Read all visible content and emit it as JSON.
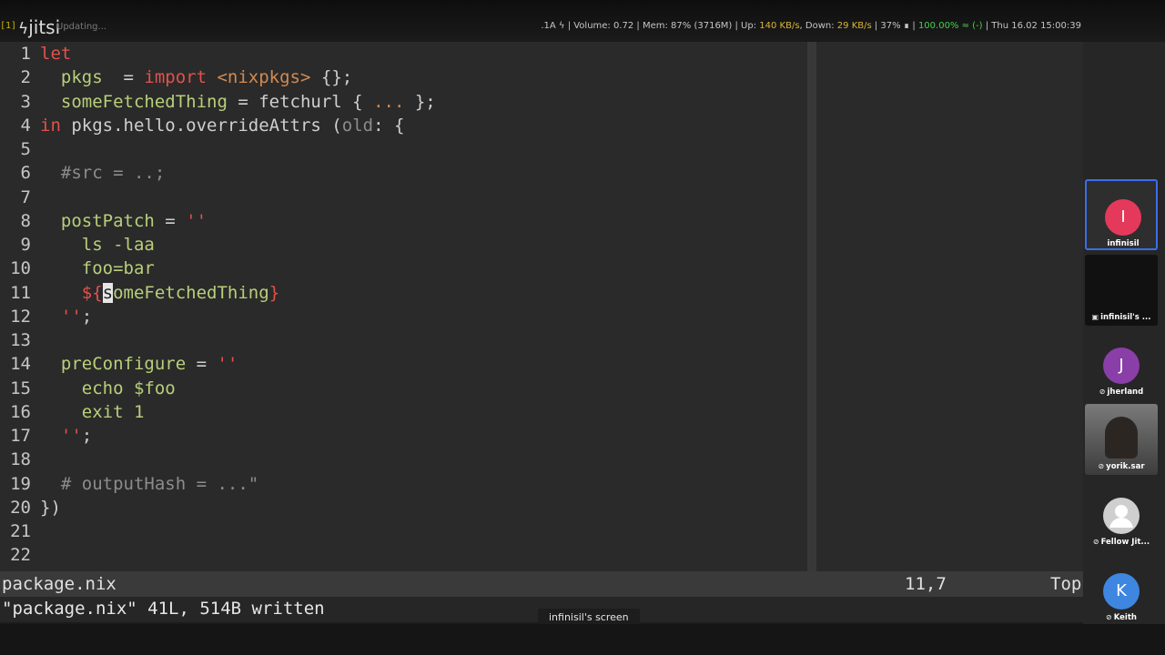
{
  "taskbar": {
    "workspace": "[1]",
    "app_name": "jitsi",
    "app_icon": "jitsi-bolt-icon",
    "updating_text": "Updating...",
    "status": {
      "prefix": ".1A ϟ | Volume: 0.72 | Mem: 87% (3716M) | Up: ",
      "up_speed": "140 KB/s",
      "down_label": ", Down: ",
      "down_speed": "29 KB/s",
      "battery": " | 37% ∎ | ",
      "charge": "100.00% ≈ (-)",
      "datetime": " | Thu 16.02 15:00:39"
    }
  },
  "editor": {
    "lines": [
      {
        "n": "1",
        "t": [
          [
            "kw",
            "let"
          ]
        ]
      },
      {
        "n": "2",
        "t": [
          [
            "id",
            "  pkgs"
          ],
          [
            "",
            "  = "
          ],
          [
            "kw",
            "import"
          ],
          [
            "",
            ""
          ],
          [
            "pth",
            " <nixpkgs>"
          ],
          [
            "",
            ""
          ],
          [
            "",
            " {};"
          ]
        ]
      },
      {
        "n": "3",
        "t": [
          [
            "id",
            "  someFetchedThing"
          ],
          [
            "",
            " = fetchurl { "
          ],
          [
            "nm",
            "..."
          ],
          [
            "",
            " };"
          ]
        ]
      },
      {
        "n": "4",
        "t": [
          [
            "kw",
            "in"
          ],
          [
            "",
            " pkgs.hello.overrideAttrs ("
          ],
          [
            "cm",
            "old"
          ],
          [
            "",
            ": {"
          ]
        ]
      },
      {
        "n": "5",
        "t": []
      },
      {
        "n": "6",
        "t": [
          [
            "cm",
            "  #src = ..;"
          ]
        ]
      },
      {
        "n": "7",
        "t": []
      },
      {
        "n": "8",
        "t": [
          [
            "id",
            "  postPatch"
          ],
          [
            "",
            " = "
          ],
          [
            "str",
            "''"
          ]
        ]
      },
      {
        "n": "9",
        "t": [
          [
            "id",
            "    ls -laa"
          ]
        ]
      },
      {
        "n": "10",
        "t": [
          [
            "id",
            "    foo=bar"
          ]
        ]
      },
      {
        "n": "11",
        "t": [
          [
            "str",
            "    ${"
          ],
          [
            "cur",
            "s"
          ],
          [
            "id",
            "omeFetchedThing"
          ],
          [
            "str",
            "}"
          ]
        ]
      },
      {
        "n": "12",
        "t": [
          [
            "str",
            "  ''"
          ],
          [
            "",
            ";"
          ]
        ]
      },
      {
        "n": "13",
        "t": []
      },
      {
        "n": "14",
        "t": [
          [
            "id",
            "  preConfigure"
          ],
          [
            "",
            " = "
          ],
          [
            "str",
            "''"
          ]
        ]
      },
      {
        "n": "15",
        "t": [
          [
            "id",
            "    echo $foo"
          ]
        ]
      },
      {
        "n": "16",
        "t": [
          [
            "id",
            "    exit 1"
          ]
        ]
      },
      {
        "n": "17",
        "t": [
          [
            "str",
            "  ''"
          ],
          [
            "",
            ";"
          ]
        ]
      },
      {
        "n": "18",
        "t": []
      },
      {
        "n": "19",
        "t": [
          [
            "cm",
            "  # outputHash = ...\""
          ]
        ]
      },
      {
        "n": "20",
        "t": [
          [
            "",
            "})"
          ]
        ]
      },
      {
        "n": "21",
        "t": []
      },
      {
        "n": "22",
        "t": []
      }
    ],
    "status_file": "package.nix",
    "status_pos": "11,7",
    "status_scroll": "Top",
    "command_line": "\"package.nix\" 41L, 514B written"
  },
  "screen_share_label": "infinisil's screen",
  "participants": [
    {
      "name": "infinisil",
      "initial": "I",
      "color": "#e5395b",
      "kind": "avatar",
      "active": true
    },
    {
      "name": "infinisil's ...",
      "initial": "",
      "color": "#111111",
      "kind": "screen",
      "active": false
    },
    {
      "name": "jherland",
      "initial": "J",
      "color": "#8a3ea8",
      "kind": "avatar",
      "active": false
    },
    {
      "name": "yorik.sar",
      "initial": "",
      "color": "#5a5a5a",
      "kind": "video",
      "active": false
    },
    {
      "name": "Fellow Jit...",
      "initial": "",
      "color": "#cfcfcf",
      "kind": "generic",
      "active": false
    },
    {
      "name": "Keith",
      "initial": "K",
      "color": "#3e86e0",
      "kind": "avatar",
      "active": false
    }
  ]
}
